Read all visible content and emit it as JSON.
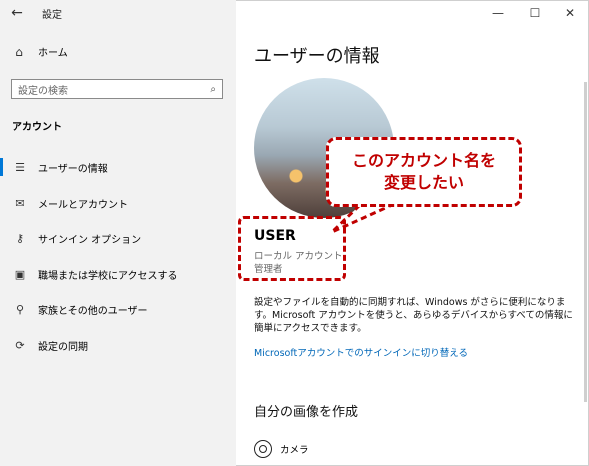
{
  "app": {
    "title": "設定"
  },
  "sidebar": {
    "home_label": "ホーム",
    "search_placeholder": "設定の検索",
    "section_title": "アカウント",
    "items": [
      {
        "label": "ユーザーの情報",
        "icon": "user-info-icon"
      },
      {
        "label": "メールとアカウント",
        "icon": "mail-icon"
      },
      {
        "label": "サインイン オプション",
        "icon": "key-icon"
      },
      {
        "label": "職場または学校にアクセスする",
        "icon": "briefcase-icon"
      },
      {
        "label": "家族とその他のユーザー",
        "icon": "add-person-icon"
      },
      {
        "label": "設定の同期",
        "icon": "sync-icon"
      }
    ]
  },
  "window": {
    "minimize": "—",
    "maximize": "☐",
    "close": "✕"
  },
  "main": {
    "title": "ユーザーの情報",
    "user_name": "USER",
    "account_type": "ローカル アカウント",
    "role": "管理者",
    "description": "設定やファイルを自動的に同期すれば、Windows がさらに便利になります。Microsoft アカウントを使うと、あらゆるデバイスからすべての情報に簡単にアクセスできます。",
    "link": "Microsoftアカウントでのサインインに切り替える",
    "create_picture_title": "自分の画像を作成",
    "camera_label": "カメラ"
  },
  "annotation": {
    "text": "このアカウント名を\n変更したい",
    "color": "#c00000"
  },
  "colors": {
    "accent": "#0078d7",
    "link": "#0067b8",
    "sidebar_bg": "#f2f2f2"
  }
}
